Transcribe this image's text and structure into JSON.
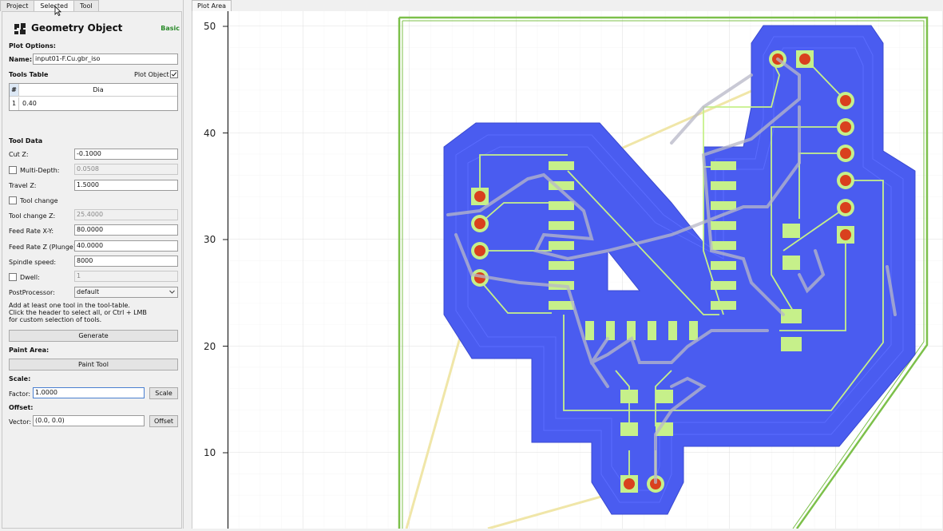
{
  "tabs": [
    "Project",
    "Selected",
    "Tool"
  ],
  "panel": {
    "title": "Geometry Object",
    "mode_badge": "Basic",
    "plot_options": "Plot Options:",
    "name_label": "Name:",
    "name_value": "input01-F.Cu.gbr_iso",
    "tools_table_label": "Tools Table",
    "plot_object_label": "Plot Object",
    "table_headers": [
      "#",
      "Dia"
    ],
    "table_rows": [
      {
        "num": "1",
        "dia": "0.40"
      }
    ],
    "tool_data": "Tool Data",
    "cut_z_label": "Cut Z:",
    "cut_z": "-0.1000",
    "multi_depth_label": "Multi-Depth:",
    "multi_depth": "0.0508",
    "travel_z_label": "Travel Z:",
    "travel_z": "1.5000",
    "tool_change_label": "Tool change",
    "tool_change_z_label": "Tool change Z:",
    "tool_change_z": "25.4000",
    "feed_xy_label": "Feed Rate X-Y:",
    "feed_xy": "80.0000",
    "feed_z_label": "Feed Rate Z (Plunge):",
    "feed_z": "40.0000",
    "spindle_label": "Spindle speed:",
    "spindle": "8000",
    "dwell_label": "Dwell:",
    "dwell": "1",
    "postproc_label": "PostProcessor:",
    "postproc": "default",
    "hint_1": "Add at least one tool in the tool-table.",
    "hint_2": "Click the header to select all, or Ctrl + LMB",
    "hint_3": "for custom selection of tools.",
    "generate": "Generate",
    "paint_area": "Paint Area:",
    "paint_tool": "Paint Tool",
    "scale": "Scale:",
    "factor_label": "Factor:",
    "factor": "1.0000",
    "scale_btn": "Scale",
    "offset": "Offset:",
    "vector_label": "Vector:",
    "vector": "(0.0, 0.0)",
    "offset_btn": "Offset"
  },
  "plot": {
    "tab": "Plot Area",
    "y_ticks": [
      "50",
      "40",
      "30",
      "20",
      "10"
    ],
    "colors": {
      "copper": "#4a5cf0",
      "trace": "#c6f08a",
      "pad": "#d9401e",
      "outline": "#7cc04a",
      "travel": "#f0e6a8"
    }
  }
}
